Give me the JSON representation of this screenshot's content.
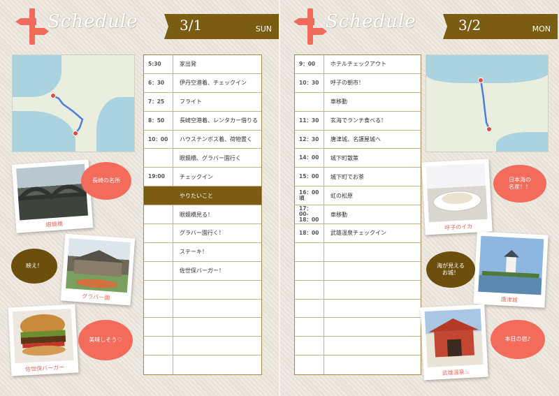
{
  "left_page": {
    "header": {
      "title": "Schedule",
      "date": "3/1",
      "weekday": "SUN",
      "icon": "signpost-icon"
    },
    "schedule": [
      {
        "time": "5:30",
        "event": "家出発"
      },
      {
        "time": "6：30",
        "event": "伊丹空港着、チェックイン"
      },
      {
        "time": "7：25",
        "event": "フライト"
      },
      {
        "time": "8：50",
        "event": "長崎空港着、レンタカー借りる"
      },
      {
        "time": "10：00",
        "event": "ハウステンボス着、荷物置く"
      },
      {
        "time": "",
        "event": "眼鏡橋、グラバー園行く"
      },
      {
        "time": "19:00",
        "event": "チェックイン"
      },
      {
        "time": "",
        "event": "やりたいこと"
      },
      {
        "time": "",
        "event": "眼鏡橋見る！"
      },
      {
        "time": "",
        "event": "グラバー園行く！"
      },
      {
        "time": "",
        "event": "ステーキ！"
      },
      {
        "time": "",
        "event": "佐世保バーガー！"
      },
      {
        "time": "",
        "event": ""
      },
      {
        "time": "",
        "event": ""
      },
      {
        "time": "",
        "event": ""
      },
      {
        "time": "",
        "event": ""
      },
      {
        "time": "",
        "event": ""
      }
    ],
    "highlight_label": "やりたいこと",
    "photos": [
      {
        "caption": "眼鏡橋",
        "bubble": "長崎の名所"
      },
      {
        "caption": "グラバー園",
        "bubble": "映え！"
      },
      {
        "caption": "佐世保バーガー",
        "bubble": "美味しそう♡"
      }
    ]
  },
  "right_page": {
    "header": {
      "title": "Schedule",
      "date": "3/2",
      "weekday": "MON",
      "icon": "signpost-icon"
    },
    "schedule": [
      {
        "time": "9：00",
        "event": "ホテルチェックアウト"
      },
      {
        "time": "10：30",
        "event": "呼子の朝市！"
      },
      {
        "time": "",
        "event": "車移動"
      },
      {
        "time": "11：30",
        "event": "玄海でランチ食べる！"
      },
      {
        "time": "12：30",
        "event": "唐津城、名護屋城へ"
      },
      {
        "time": "14：00",
        "event": "城下町散策"
      },
      {
        "time": "15：00",
        "event": "城下町でお茶"
      },
      {
        "time": "16：00\n頃",
        "event": "虹の松原"
      },
      {
        "time": "17：\n00-\n18：00",
        "event": "車移動"
      },
      {
        "time": "18：00",
        "event": "武雄温泉チェックイン"
      },
      {
        "time": "",
        "event": ""
      },
      {
        "time": "",
        "event": ""
      },
      {
        "time": "",
        "event": ""
      },
      {
        "time": "",
        "event": ""
      },
      {
        "time": "",
        "event": ""
      },
      {
        "time": "",
        "event": ""
      },
      {
        "time": "",
        "event": ""
      }
    ],
    "photos": [
      {
        "caption": "呼子のイカ",
        "bubble": "日本海の\n名産！！"
      },
      {
        "caption": "唐津城",
        "bubble": "海が見える\nお城！"
      },
      {
        "caption": "武雄温泉♨",
        "bubble": "本日の宿♪"
      }
    ]
  },
  "colors": {
    "accent": "#7a5c12",
    "coral": "#f26b5b",
    "paper": "#ece6dc"
  }
}
